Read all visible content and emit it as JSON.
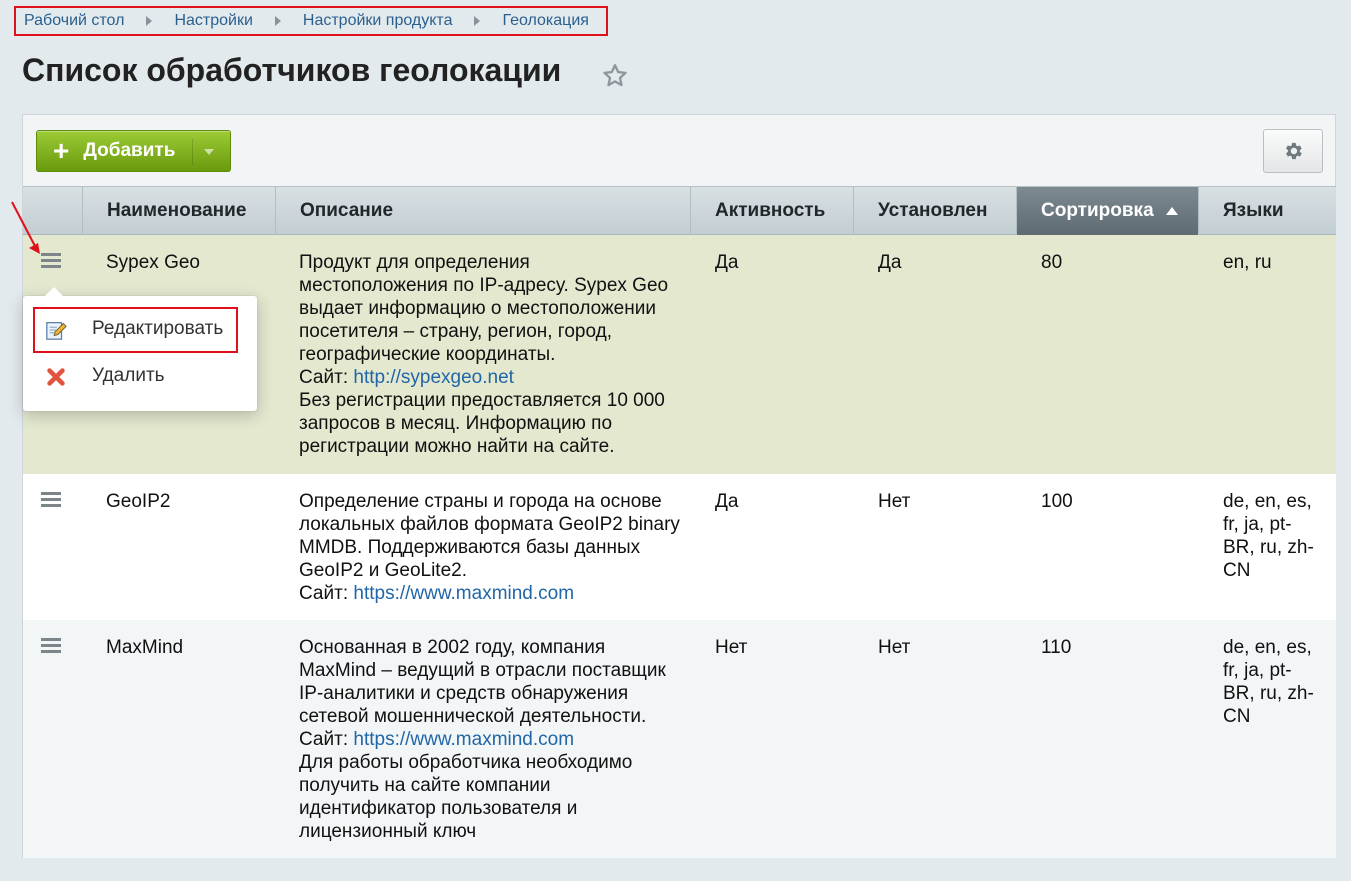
{
  "breadcrumb": [
    "Рабочий стол",
    "Настройки",
    "Настройки продукта",
    "Геолокация"
  ],
  "page_title": "Список обработчиков геолокации",
  "toolbar": {
    "add_label": "Добавить"
  },
  "table": {
    "columns": [
      "Наименование",
      "Описание",
      "Активность",
      "Установлен",
      "Сортировка",
      "Языки"
    ],
    "sorted_column": "Сортировка",
    "rows": [
      {
        "name": "Sypex Geo",
        "description": {
          "pre": "Продукт для определения\nместоположения по IP-адресу. Sypex Geo\nвыдает информацию о местоположении\nпосетителя – страну, регион, город,\nгеографические координаты.",
          "site_label": "Сайт: ",
          "site_link": "http://sypexgeo.net",
          "post": "Без регистрации предоставляется 10 000\nзапросов в месяц. Информацию по\nрегистрации можно найти на сайте."
        },
        "active": "Да",
        "installed": "Да",
        "sort": "80",
        "languages": "en, ru"
      },
      {
        "name": "GeoIP2",
        "description": {
          "pre": "Определение страны и города на основе\nлокальных файлов формата GeoIP2 binary\nMMDB. Поддерживаются базы данных\nGeoIP2 и GeoLite2.",
          "site_label": "Сайт: ",
          "site_link": "https://www.maxmind.com",
          "post": ""
        },
        "active": "Да",
        "installed": "Нет",
        "sort": "100",
        "languages": "de, en, es,\nfr, ja, pt-\nBR, ru, zh-\nCN"
      },
      {
        "name": "MaxMind",
        "description": {
          "pre": "Основанная в 2002 году, компания\nMaxMind – ведущий в отрасли поставщик\nIP-аналитики и средств обнаружения\nсетевой мошеннической деятельности.",
          "site_label": "Сайт: ",
          "site_link": "https://www.maxmind.com",
          "post": "Для работы обработчика необходимо\nполучить на сайте компании\nидентификатор пользователя и\nлицензионный ключ"
        },
        "active": "Нет",
        "installed": "Нет",
        "sort": "110",
        "languages": "de, en, es,\nfr, ja, pt-\nBR, ru, zh-\nCN"
      }
    ]
  },
  "context_menu": {
    "items": [
      "Редактировать",
      "Удалить"
    ]
  },
  "colors": {
    "row_highlight": "#e3e8cf",
    "row_white": "#ffffff",
    "row_alt": "#f2f6f7",
    "link": "#2166a8",
    "annotation_red": "#e0101a"
  }
}
